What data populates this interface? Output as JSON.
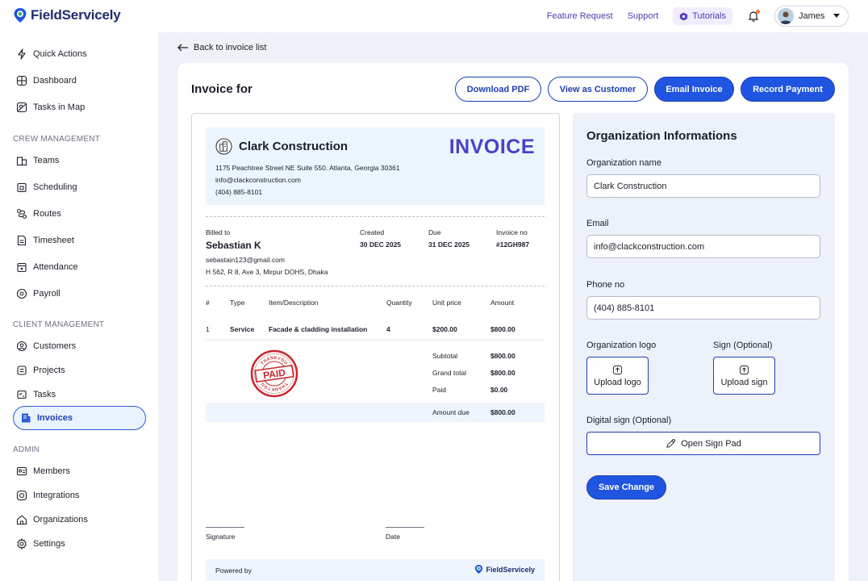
{
  "brand": {
    "name": "FieldServicely"
  },
  "topbar": {
    "feature_request": "Feature Request",
    "support": "Support",
    "tutorials": "Tutorials",
    "user_name": "James"
  },
  "sidebar": {
    "top_items": [
      {
        "label": "Quick Actions",
        "icon": "lightning-icon"
      },
      {
        "label": "Dashboard",
        "icon": "dashboard-icon"
      },
      {
        "label": "Tasks in Map",
        "icon": "map-icon"
      }
    ],
    "crew_section": "CREW MANAGEMENT",
    "crew_items": [
      {
        "label": "Teams",
        "icon": "teams-icon"
      },
      {
        "label": "Scheduling",
        "icon": "calendar-icon"
      },
      {
        "label": "Routes",
        "icon": "route-icon"
      },
      {
        "label": "Timesheet",
        "icon": "timesheet-icon"
      },
      {
        "label": "Attendance",
        "icon": "attendance-icon"
      },
      {
        "label": "Payroll",
        "icon": "payroll-icon"
      }
    ],
    "client_section": "CLIENT MANAGEMENT",
    "client_items": [
      {
        "label": "Customers",
        "icon": "customers-icon"
      },
      {
        "label": "Projects",
        "icon": "projects-icon"
      },
      {
        "label": "Tasks",
        "icon": "tasks-icon"
      },
      {
        "label": "Invoices",
        "icon": "invoice-icon",
        "active": true
      }
    ],
    "admin_section": "ADMIN",
    "admin_items": [
      {
        "label": "Members",
        "icon": "members-icon"
      },
      {
        "label": "Integrations",
        "icon": "integrations-icon"
      },
      {
        "label": "Organizations",
        "icon": "organizations-icon"
      },
      {
        "label": "Settings",
        "icon": "gear-icon"
      }
    ]
  },
  "main": {
    "back_label": "Back to invoice list",
    "title": "Invoice for",
    "buttons": {
      "download_pdf": "Download PDF",
      "view_as_customer": "View as Customer",
      "email_invoice": "Email Invoice",
      "record_payment": "Record Payment"
    }
  },
  "invoice": {
    "company_name": "Clark Construction",
    "heading": "INVOICE",
    "address": "1175 Peachtree Street NE Suite 550. Atlanta, Georgia 30361",
    "email": "info@clackconstruction.com",
    "phone": "(404) 885-8101",
    "billed_to_label": "Billed to",
    "billed_to_name": "Sebastian K",
    "billed_to_email": "sebastain123@gmail.com",
    "billed_to_address": "H 562, R 8, Ave 3, Mirpur DOHS, Dhaka",
    "created_label": "Created",
    "created_value": "30 DEC 2025",
    "due_label": "Due",
    "due_value": "31 DEC 2025",
    "invoice_no_label": "Invoice no",
    "invoice_no_value": "#12GH987",
    "columns": [
      "#",
      "Type",
      "Item/Description",
      "Quantity",
      "Unit price",
      "Amount"
    ],
    "rows": [
      {
        "num": "1",
        "type": "Service",
        "description": "Facade & cladding installation",
        "quantity": "4",
        "unit_price": "$200.00",
        "amount": "$800.00"
      }
    ],
    "totals": [
      {
        "label": "Subtotal",
        "value": "$800.00"
      },
      {
        "label": "Grand total",
        "value": "$800.00"
      },
      {
        "label": "Paid",
        "value": "$0.00"
      }
    ],
    "amount_due_label": "Amount due",
    "amount_due_value": "$800.00",
    "stamp_main": "PAID",
    "stamp_ring_top": "THANKYOU",
    "stamp_ring_bottom": "THANKYOU",
    "signature_label": "Signature",
    "date_label": "Date",
    "powered_by": "Powered by",
    "powered_brand": "FieldServicely"
  },
  "org_panel": {
    "title": "Organization Informations",
    "org_name_label": "Organization name",
    "org_name_value": "Clark Construction",
    "email_label": "Email",
    "email_value": "info@clackconstruction.com",
    "phone_label": "Phone no",
    "phone_value": "(404) 885-8101",
    "logo_label": "Organization logo",
    "logo_button": "Upload logo",
    "sign_label": "Sign (Optional)",
    "sign_button": "Upload sign",
    "digital_sign_label": "Digital sign (Optional)",
    "sign_pad_button": "Open Sign Pad",
    "save_button": "Save Change"
  },
  "colors": {
    "primary": "#1f55e0",
    "accent": "#4a42c6",
    "stamp": "#c8252b"
  }
}
